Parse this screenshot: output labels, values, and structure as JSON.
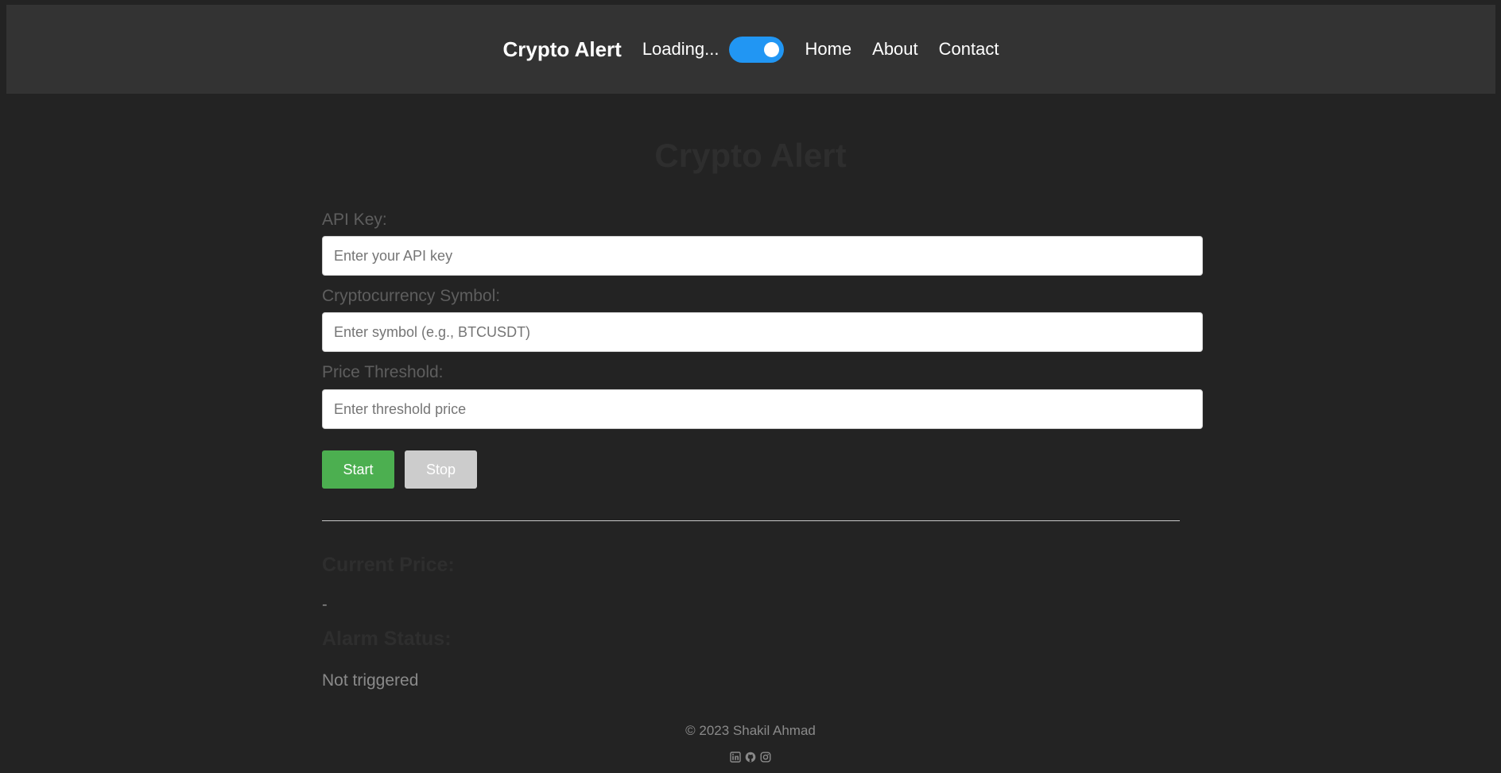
{
  "navbar": {
    "brand": "Crypto Alert",
    "loading_text": "Loading...",
    "toggle_state": "on",
    "links": [
      {
        "label": "Home"
      },
      {
        "label": "About"
      },
      {
        "label": "Contact"
      }
    ]
  },
  "main": {
    "title": "Crypto Alert",
    "fields": {
      "api_key": {
        "label": "API Key:",
        "placeholder": "Enter your API key",
        "value": ""
      },
      "symbol": {
        "label": "Cryptocurrency Symbol:",
        "placeholder": "Enter symbol (e.g., BTCUSDT)",
        "value": ""
      },
      "threshold": {
        "label": "Price Threshold:",
        "placeholder": "Enter threshold price",
        "value": ""
      }
    },
    "buttons": {
      "start_label": "Start",
      "stop_label": "Stop"
    },
    "current_price": {
      "heading": "Current Price:",
      "value": "-"
    },
    "alarm_status": {
      "heading": "Alarm Status:",
      "value": "Not triggered"
    }
  },
  "footer": {
    "copyright": "© 2023 Shakil Ahmad",
    "social_icons": [
      "linkedin-icon",
      "github-icon",
      "instagram-icon"
    ]
  },
  "colors": {
    "page_background": "#232323",
    "navbar_background": "#333333",
    "toggle_accent": "#2196f3",
    "start_button": "#4caf50",
    "stop_button": "#cccccc"
  }
}
